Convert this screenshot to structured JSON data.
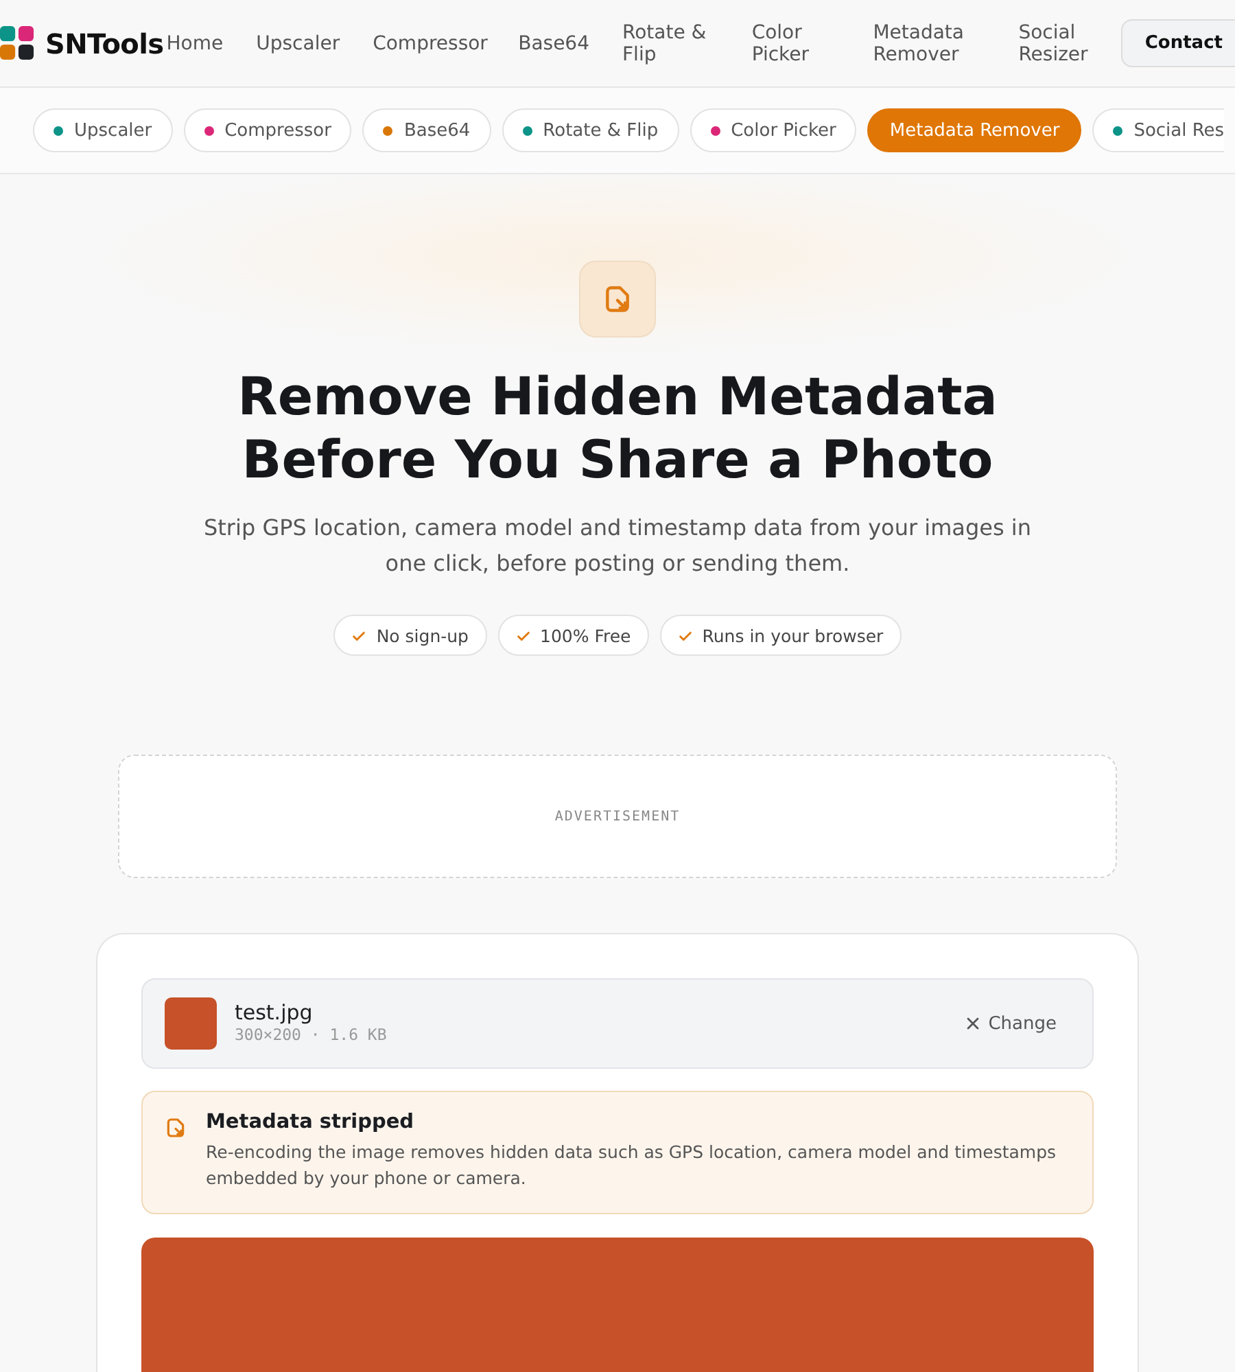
{
  "header": {
    "brand": "SNTools",
    "nav": [
      {
        "label": "Home"
      },
      {
        "label": "Upscaler"
      },
      {
        "label": "Compressor"
      },
      {
        "label": "Base64"
      },
      {
        "label": "Rotate & Flip"
      },
      {
        "label": "Color Picker"
      },
      {
        "label": "Metadata Remover"
      },
      {
        "label": "Social Resizer"
      }
    ],
    "contact": "Contact"
  },
  "tool_chips": [
    {
      "label": "Upscaler",
      "color": "#0d9488",
      "selected": false
    },
    {
      "label": "Compressor",
      "color": "#db2777",
      "selected": false
    },
    {
      "label": "Base64",
      "color": "#d97706",
      "selected": false
    },
    {
      "label": "Rotate & Flip",
      "color": "#0d9488",
      "selected": false
    },
    {
      "label": "Color Picker",
      "color": "#db2777",
      "selected": false
    },
    {
      "label": "Metadata Remover",
      "selected": true
    },
    {
      "label": "Social Res",
      "color": "#0d9488",
      "selected": false
    }
  ],
  "hero": {
    "title": "Remove Hidden Metadata Before You Share a Photo",
    "subtitle": "Strip GPS location, camera model and timestamp data from your images in one click, before posting or sending them.",
    "badges": [
      "No sign-up",
      "100% Free",
      "Runs in your browser"
    ]
  },
  "ad": {
    "label": "ADVERTISEMENT"
  },
  "file": {
    "name": "test.jpg",
    "meta": "300×200 · 1.6 KB",
    "change": "Change"
  },
  "notice": {
    "title": "Metadata stripped",
    "text": "Re-encoding the image removes hidden data such as GPS location, camera model and timestamps embedded by your phone or camera."
  }
}
